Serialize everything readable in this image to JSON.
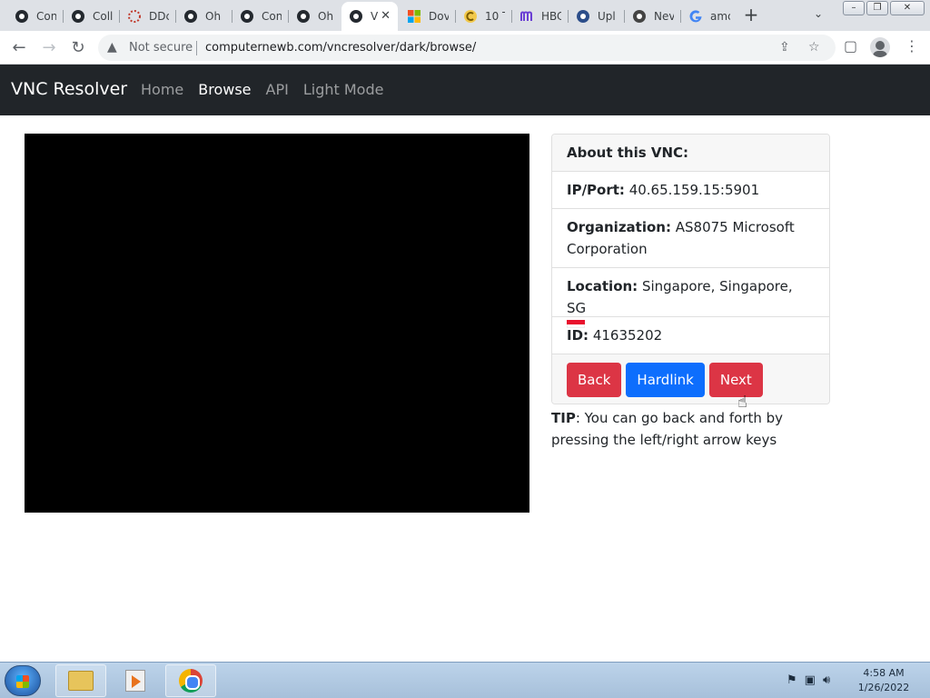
{
  "browser": {
    "tabs": [
      {
        "label": "Con",
        "icon": "github-icon"
      },
      {
        "label": "Coll",
        "icon": "github-icon"
      },
      {
        "label": "DDc",
        "icon": "ddos-icon"
      },
      {
        "label": "Oh",
        "icon": "github-icon"
      },
      {
        "label": "Con",
        "icon": "github-icon"
      },
      {
        "label": "Oh",
        "icon": "github-icon"
      },
      {
        "label": "V",
        "icon": "github-icon",
        "active": true
      },
      {
        "label": "Dov",
        "icon": "microsoft-icon"
      },
      {
        "label": "10 T",
        "icon": "c-icon"
      },
      {
        "label": "HBC",
        "icon": "m-icon"
      },
      {
        "label": "Upl",
        "icon": "upload-icon"
      },
      {
        "label": "Nev",
        "icon": "github-icon"
      },
      {
        "label": "amc",
        "icon": "google-icon"
      }
    ],
    "not_secure": "Not secure",
    "url": "computernewb.com/vncresolver/dark/browse/"
  },
  "site": {
    "brand": "VNC Resolver",
    "nav": {
      "home": "Home",
      "browse": "Browse",
      "api": "API",
      "light": "Light Mode"
    }
  },
  "vnc": {
    "title": "About this VNC:",
    "ip_label": "IP/Port:",
    "ip": "40.65.159.15:5901",
    "org_label": "Organization:",
    "org": "AS8075 Microsoft Corporation",
    "loc_label": "Location:",
    "loc": "Singapore, Singapore, SG",
    "id_label": "ID:",
    "id": "41635202",
    "buttons": {
      "back": "Back",
      "hardlink": "Hardlink",
      "next": "Next"
    },
    "colors": {
      "danger": "#dc3545",
      "primary": "#0d6efd"
    }
  },
  "tip": {
    "label": "TIP",
    "text": ": You can go back and forth by pressing the left/right arrow keys"
  },
  "taskbar": {
    "time": "4:58 AM",
    "date": "1/26/2022"
  }
}
